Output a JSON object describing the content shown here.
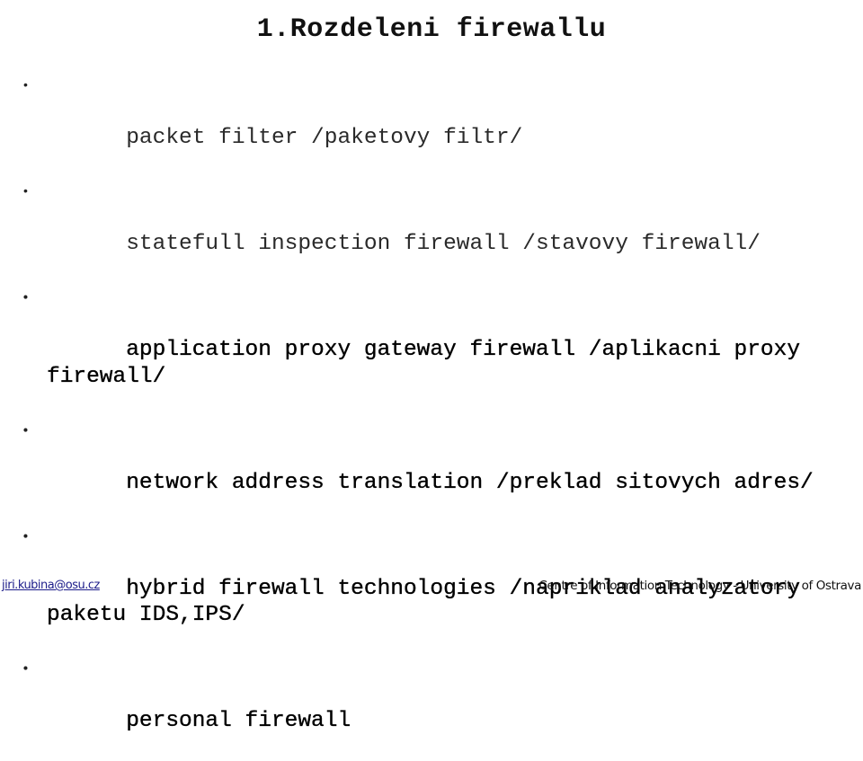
{
  "slide": {
    "title": "1.Rozdeleni firewallu",
    "items": [
      {
        "text": "packet filter /paketovy filtr/"
      },
      {
        "text": "statefull inspection firewall /stavovy firewall/"
      },
      {
        "text": "application proxy gateway firewall /aplikacni proxy firewall/"
      },
      {
        "text": "network address translation /preklad sitovych adres/"
      },
      {
        "text": "hybrid firewall technologies /napriklad analyzatory paketu IDS,IPS/"
      },
      {
        "text": "personal firewall"
      }
    ],
    "bullet_glyph": "•"
  },
  "footer": {
    "email": "jiri.kubina@osu.cz",
    "organization": "Centre of Information Technology - University of Ostrava"
  }
}
